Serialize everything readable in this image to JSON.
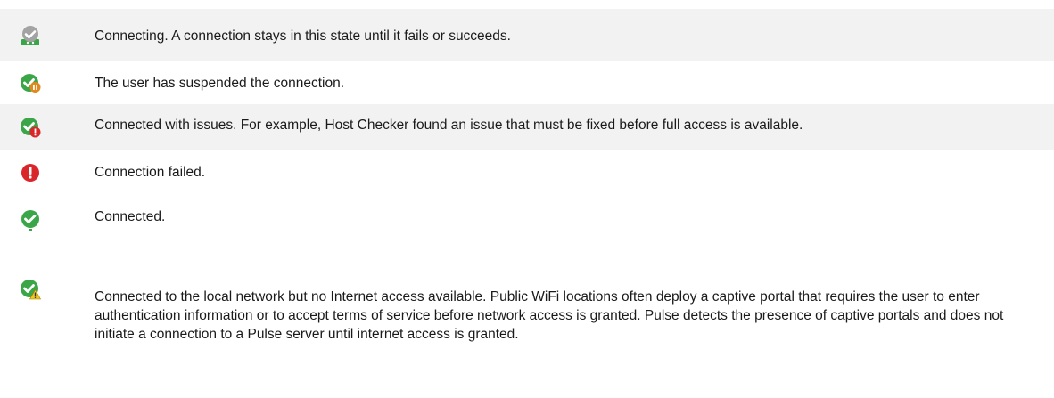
{
  "status_table": {
    "rows": [
      {
        "icon": "connecting-status-icon",
        "text": "Connecting. A connection stays in this state until it fails or succeeds."
      },
      {
        "icon": "suspended-status-icon",
        "text": "The user has suspended the connection."
      },
      {
        "icon": "connected-with-issues-status-icon",
        "text": "Connected with issues. For example, Host Checker found an issue that must be fixed before full access is available."
      },
      {
        "icon": "connection-failed-status-icon",
        "text": "Connection failed."
      },
      {
        "icon": "connected-status-icon",
        "text": "Connected."
      },
      {
        "icon": "captive-portal-status-icon",
        "text": "Connected to the local network but no Internet access available. Public WiFi locations often deploy a captive portal that requires the user to enter authentication information or to accept terms of service before network access is granted. Pulse detects the presence of captive portals and does not initiate a connection to a Pulse server until internet access is granted."
      }
    ]
  },
  "colors": {
    "connected_green": "#3aa648",
    "failed_red": "#d9262b",
    "connecting_gray": "#9a9a9a",
    "suspend_orange": "#e08a1e",
    "warning_yellow": "#f2c81e",
    "row_shade": "#f2f2f2",
    "separator": "#8c8c8c"
  }
}
